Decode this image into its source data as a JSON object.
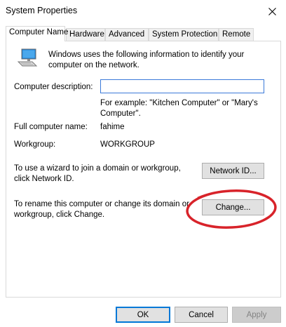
{
  "window": {
    "title": "System Properties",
    "close_glyph": "✕"
  },
  "tabs": [
    {
      "label": "Computer Name",
      "active": true
    },
    {
      "label": "Hardware",
      "active": false
    },
    {
      "label": "Advanced",
      "active": false
    },
    {
      "label": "System Protection",
      "active": false
    },
    {
      "label": "Remote",
      "active": false
    }
  ],
  "panel": {
    "intro": "Windows uses the following information to identify your computer on the network.",
    "description_label": "Computer description:",
    "description_value": "",
    "example_text": "For example: \"Kitchen Computer\" or \"Mary's Computer\".",
    "full_name_label": "Full computer name:",
    "full_name_value": "fahime",
    "workgroup_label": "Workgroup:",
    "workgroup_value": "WORKGROUP",
    "network_text": "To use a wizard to join a domain or workgroup, click Network ID.",
    "network_button": "Network ID...",
    "rename_text": "To rename this computer or change its domain or workgroup, click Change.",
    "change_button": "Change..."
  },
  "footer": {
    "ok": "OK",
    "cancel": "Cancel",
    "apply": "Apply"
  },
  "colors": {
    "annotation": "#d8232a",
    "input_border": "#3a7ad9"
  }
}
